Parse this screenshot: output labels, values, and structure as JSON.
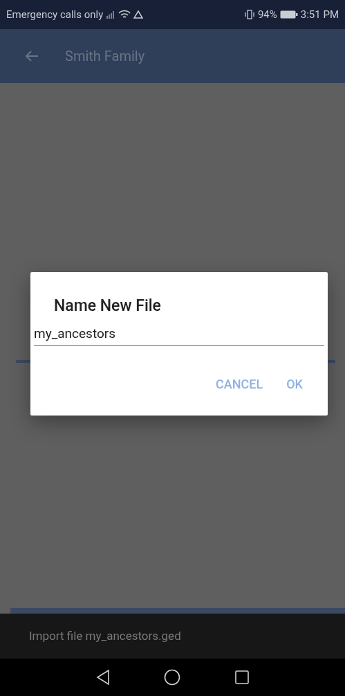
{
  "status_bar": {
    "carrier": "Emergency calls only",
    "battery": "94%",
    "time": "3:51 PM"
  },
  "app_bar": {
    "title": "Smith Family"
  },
  "dialog": {
    "title": "Name New File",
    "value": "my_ancestors",
    "buttons": [
      "CANCEL",
      "OK"
    ]
  },
  "snackbar": {
    "message": "Import file my_ancestors.ged"
  }
}
